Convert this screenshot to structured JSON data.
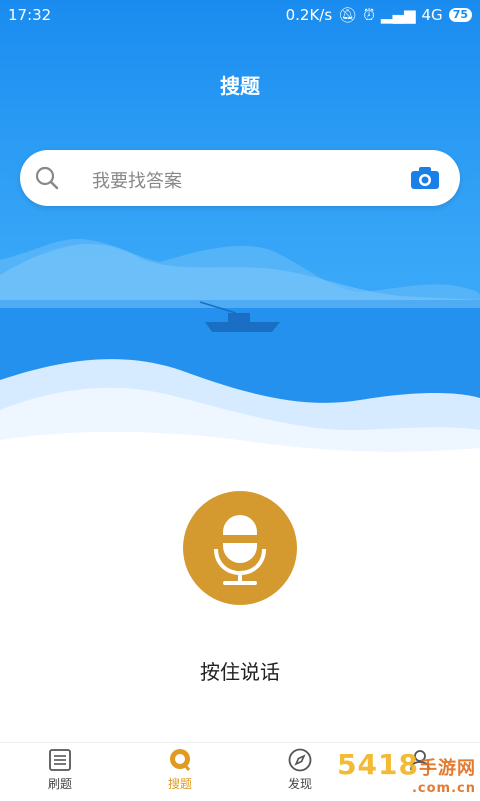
{
  "status": {
    "time": "17:32",
    "speed": "0.2K/s",
    "network": "4G",
    "battery": "75"
  },
  "page": {
    "title": "搜题"
  },
  "search": {
    "placeholder": "我要找答案"
  },
  "voice": {
    "label": "按住说话"
  },
  "colors": {
    "primary": "#1a8cf0",
    "accent": "#d59a2f",
    "tab_active": "#e09b21"
  },
  "tabs": [
    {
      "label": "刷题",
      "icon": "list-icon"
    },
    {
      "label": "搜题",
      "icon": "search-tab-icon",
      "active": true
    },
    {
      "label": "发现",
      "icon": "compass-icon"
    },
    {
      "label": "",
      "icon": "profile-icon"
    }
  ],
  "watermark": {
    "text": "5418",
    "sub": "手游网",
    "domain": ".com.cn"
  }
}
